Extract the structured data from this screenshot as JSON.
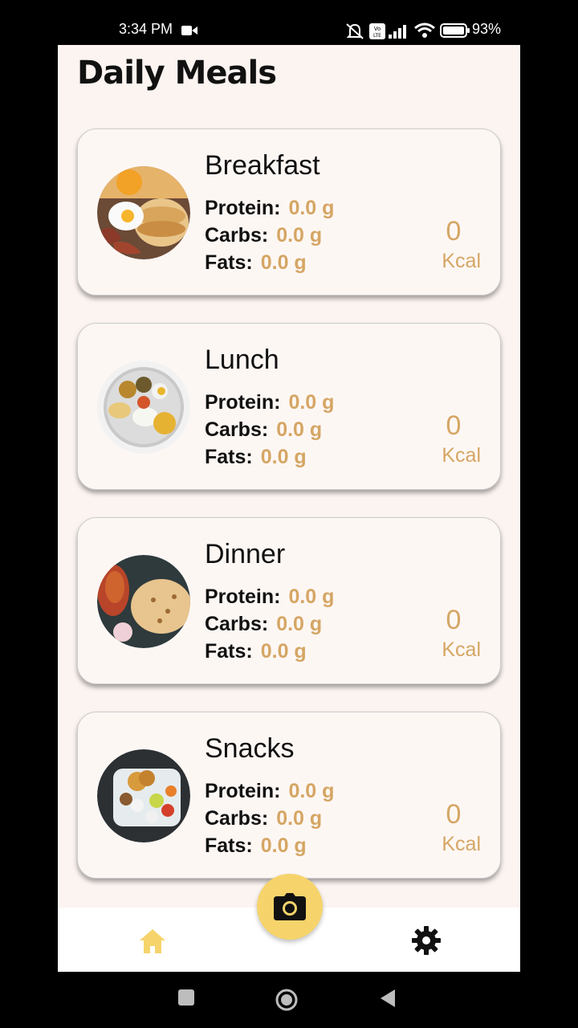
{
  "status": {
    "time": "3:34 PM",
    "battery": "93%"
  },
  "page": {
    "title": "Daily Meals"
  },
  "meals": [
    {
      "name": "Breakfast",
      "protein_label": "Protein:",
      "protein": "0.0 g",
      "carbs_label": "Carbs:",
      "carbs": "0.0 g",
      "fats_label": "Fats:",
      "fats": "0.0 g",
      "kcal": "0",
      "kcal_unit": "Kcal"
    },
    {
      "name": "Lunch",
      "protein_label": "Protein:",
      "protein": "0.0 g",
      "carbs_label": "Carbs:",
      "carbs": "0.0 g",
      "fats_label": "Fats:",
      "fats": "0.0 g",
      "kcal": "0",
      "kcal_unit": "Kcal"
    },
    {
      "name": "Dinner",
      "protein_label": "Protein:",
      "protein": "0.0 g",
      "carbs_label": "Carbs:",
      "carbs": "0.0 g",
      "fats_label": "Fats:",
      "fats": "0.0 g",
      "kcal": "0",
      "kcal_unit": "Kcal"
    },
    {
      "name": "Snacks",
      "protein_label": "Protein:",
      "protein": "0.0 g",
      "carbs_label": "Carbs:",
      "carbs": "0.0 g",
      "fats_label": "Fats:",
      "fats": "0.0 g",
      "kcal": "0",
      "kcal_unit": "Kcal"
    }
  ],
  "nav": {
    "home_icon": "home-icon",
    "camera_icon": "camera-icon",
    "settings_icon": "gear-icon",
    "home_color": "#f6d46b",
    "accent": "#f6d46b",
    "value_color": "#d5a664"
  }
}
